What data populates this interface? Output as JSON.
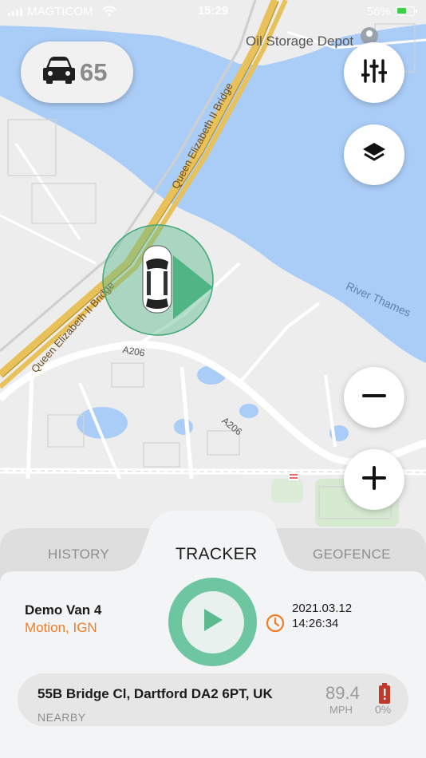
{
  "status_bar": {
    "carrier": "MAGTICOM",
    "time": "15:29",
    "battery_percent": "56%"
  },
  "map": {
    "labels": {
      "oil_depot": "Oil Storage Depot",
      "river": "River Thames",
      "bridge_upper": "Queen Elizabeth II Bridge",
      "bridge_lower": "Queen Elizabeth II Bridge",
      "road_a206_left": "A206",
      "road_a206_right": "A206"
    },
    "colors": {
      "water": "#aacdf7",
      "land": "#ecedec",
      "road": "#ffffff",
      "highway": "#e8c15a",
      "marker": "#5cba8f"
    }
  },
  "vehicle_count": {
    "icon": "car-icon",
    "count": "65"
  },
  "controls": {
    "filters_icon": "sliders-icon",
    "layers_icon": "layers-icon",
    "zoom_out_icon": "minus-icon",
    "zoom_in_icon": "plus-icon"
  },
  "tabs": [
    {
      "label": "HISTORY",
      "active": false
    },
    {
      "label": "TRACKER",
      "active": true
    },
    {
      "label": "GEOFENCE",
      "active": false
    }
  ],
  "vehicle": {
    "name": "Demo Van 4",
    "status": "Motion, IGN",
    "status_color": "#f07d25",
    "date": "2021.03.12",
    "time": "14:26:34",
    "address": "55B Bridge Cl, Dartford DA2 6PT, UK",
    "address_note": "NEARBY",
    "speed": "89.4",
    "speed_unit": "MPH",
    "battery_level": "0%",
    "battery_color": "#c0392b"
  }
}
